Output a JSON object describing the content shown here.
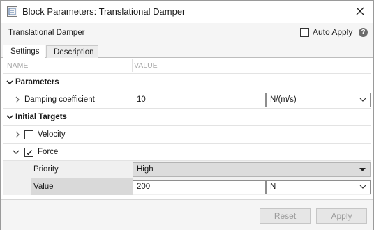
{
  "window": {
    "title": "Block Parameters: Translational Damper",
    "close_glyph": "✕"
  },
  "header": {
    "block_name": "Translational Damper",
    "auto_apply_label": "Auto Apply",
    "auto_apply_checked": false,
    "help_glyph": "?"
  },
  "tabs": [
    {
      "label": "Settings",
      "active": true
    },
    {
      "label": "Description",
      "active": false
    }
  ],
  "table": {
    "columns": {
      "name": "NAME",
      "value": "VALUE"
    },
    "sections": {
      "parameters": {
        "label": "Parameters",
        "damping": {
          "label": "Damping coefficient",
          "value": "10",
          "unit": "N/(m/s)"
        }
      },
      "initial_targets": {
        "label": "Initial Targets",
        "velocity": {
          "label": "Velocity",
          "checked": false
        },
        "force": {
          "label": "Force",
          "checked": true,
          "priority": {
            "label": "Priority",
            "value": "High"
          },
          "value": {
            "label": "Value",
            "value": "200",
            "unit": "N"
          }
        }
      }
    }
  },
  "footer": {
    "reset_label": "Reset",
    "apply_label": "Apply"
  },
  "icons": {
    "app": "block-parameters-icon",
    "close": "close-icon",
    "help": "help-icon",
    "expand": "chevron-right-icon",
    "collapse": "chevron-down-icon",
    "dropdown": "dropdown-arrow-icon"
  },
  "colors": {
    "panel_bg": "#f5f5f5",
    "row_sub_bg": "#f0f0f0",
    "selected_label_bg": "#d9d9d9",
    "popup_bg": "#dcdcdc",
    "disabled_text": "#9a9a9a"
  }
}
